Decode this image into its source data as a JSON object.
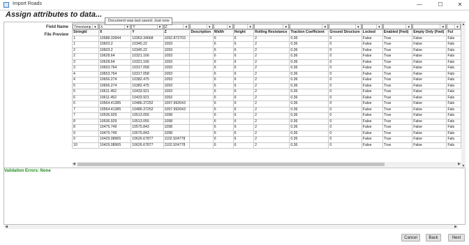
{
  "window": {
    "title": "Import Roads",
    "minimize": "—",
    "maximize": "☐",
    "close": "✕"
  },
  "heading": "Assign attributes to data...",
  "tooltip": "Document was last saved: Just now",
  "labels": {
    "field_name": "Field Name",
    "file_preview": "File Preview"
  },
  "field_selects": [
    "Timestamp",
    "X",
    "Y",
    "Z",
    "",
    "",
    "",
    "",
    "",
    "",
    "",
    "",
    "",
    ""
  ],
  "headers": [
    "StringId",
    "X",
    "Y",
    "Z",
    "Description",
    "Width",
    "Height",
    "Rolling Resistance",
    "Traction Coefficient",
    "Ground Structure",
    "Locked",
    "Enabled (Fwd)",
    "Empty Only (Fwd)",
    "Ful"
  ],
  "rows": [
    [
      "1",
      "10588.32844",
      "10363.34668",
      "1092.872703",
      "",
      "6",
      "6",
      "2",
      "0.36",
      "0",
      "False",
      "True",
      "False",
      "Fals"
    ],
    [
      "1",
      "10603.2",
      "10345.22",
      "1093",
      "",
      "6",
      "6",
      "2",
      "0.36",
      "0",
      "False",
      "True",
      "False",
      "Fals"
    ],
    [
      "2",
      "10603.2",
      "10345.22",
      "1093",
      "",
      "6",
      "6",
      "2",
      "0.36",
      "0",
      "False",
      "True",
      "False",
      "Fals"
    ],
    [
      "2",
      "10628.64",
      "10321.166",
      "1093",
      "",
      "6",
      "6",
      "2",
      "0.36",
      "0",
      "False",
      "True",
      "False",
      "Fals"
    ],
    [
      "3",
      "10628.64",
      "10321.166",
      "1093",
      "",
      "6",
      "6",
      "2",
      "0.36",
      "0",
      "False",
      "True",
      "False",
      "Fals"
    ],
    [
      "3",
      "10653.764",
      "10317.058",
      "1093",
      "",
      "6",
      "6",
      "2",
      "0.36",
      "0",
      "False",
      "True",
      "False",
      "Fals"
    ],
    [
      "4",
      "10653.764",
      "10317.058",
      "1093",
      "",
      "6",
      "6",
      "2",
      "0.36",
      "0",
      "False",
      "True",
      "False",
      "Fals"
    ],
    [
      "4",
      "10656.274",
      "10382.475",
      "1093",
      "",
      "6",
      "6",
      "2",
      "0.36",
      "0",
      "False",
      "True",
      "False",
      "Fals"
    ],
    [
      "5",
      "10656.274",
      "10382.475",
      "1093",
      "",
      "6",
      "6",
      "2",
      "0.36",
      "0",
      "False",
      "True",
      "False",
      "Fals"
    ],
    [
      "5",
      "10611.452",
      "10433.921",
      "1093",
      "",
      "6",
      "6",
      "2",
      "0.36",
      "0",
      "False",
      "True",
      "False",
      "Fals"
    ],
    [
      "6",
      "10611.452",
      "10433.921",
      "1093",
      "",
      "6",
      "6",
      "2",
      "0.36",
      "0",
      "False",
      "True",
      "False",
      "Fals"
    ],
    [
      "6",
      "10564.41385",
      "10486.37252",
      "1097.992643",
      "",
      "6",
      "6",
      "2",
      "0.36",
      "0",
      "False",
      "True",
      "False",
      "Fals"
    ],
    [
      "7",
      "10564.41385",
      "10486.37252",
      "1097.992643",
      "",
      "6",
      "6",
      "2",
      "0.36",
      "0",
      "False",
      "True",
      "False",
      "Fals"
    ],
    [
      "7",
      "10536.929",
      "10513.055",
      "1098",
      "",
      "6",
      "6",
      "2",
      "0.36",
      "0",
      "False",
      "True",
      "False",
      "Fals"
    ],
    [
      "8",
      "10536.929",
      "10513.055",
      "1098",
      "",
      "6",
      "6",
      "2",
      "0.36",
      "0",
      "False",
      "True",
      "False",
      "Fals"
    ],
    [
      "8",
      "10475.749",
      "10575.843",
      "1098",
      "",
      "6",
      "6",
      "2",
      "0.36",
      "0",
      "False",
      "True",
      "False",
      "Fals"
    ],
    [
      "9",
      "10475.749",
      "10575.843",
      "1098",
      "",
      "6",
      "6",
      "2",
      "0.36",
      "0",
      "False",
      "True",
      "False",
      "Fals"
    ],
    [
      "9",
      "10429.08965",
      "10626.67877",
      "1102.924778",
      "",
      "6",
      "6",
      "2",
      "0.36",
      "0",
      "False",
      "True",
      "False",
      "Fals"
    ],
    [
      "10",
      "10429.08965",
      "10626.67877",
      "1102.924778",
      "",
      "6",
      "6",
      "2",
      "0.36",
      "0",
      "False",
      "True",
      "False",
      "Fals"
    ]
  ],
  "validation": "Validation Errors: None",
  "buttons": {
    "cancel": "Cancel",
    "back": "Back",
    "next": "Next"
  },
  "colors": {
    "validation_green": "#1a8c1a",
    "icon_blue": "#3d7cc4"
  }
}
